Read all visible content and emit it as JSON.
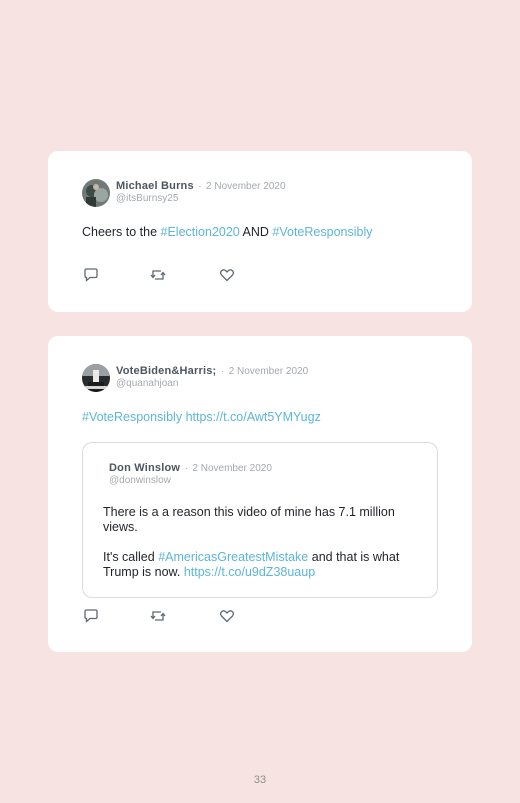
{
  "tweets": [
    {
      "author": "Michael Burns",
      "separator": "·",
      "date": "2 November 2020",
      "handle": "@itsBurnsy25",
      "text": {
        "part1": "Cheers to the ",
        "tag1": "#Election2020",
        "part2": " AND ",
        "tag2": "#VoteResponsibly"
      }
    },
    {
      "author": "VoteBiden&Harris;",
      "separator": "·",
      "date": "2 November 2020",
      "handle": "@quanahjoan",
      "text": {
        "tag1": "#VoteResponsibly",
        "space": " ",
        "link": "https://t.co/Awt5YMYugz"
      },
      "quoted": {
        "author": "Don Winslow",
        "separator": "·",
        "date": "2 November 2020",
        "handle": "@donwinslow",
        "line1": "There is a a reason this video of mine has 7.1 million views.",
        "part1": "It's called ",
        "tag1": "#AmericasGreatestMistake",
        "part2": " and that is what Trump is now. ",
        "link": "https://t.co/u9dZ38uaup"
      }
    }
  ],
  "actions": {
    "reply_icon": "reply-icon",
    "retweet_icon": "retweet-icon",
    "like_icon": "heart-icon"
  },
  "page_number": "33",
  "colors": {
    "background": "#f6e3e2",
    "card": "#ffffff",
    "hashtag": "#5db5d9"
  }
}
